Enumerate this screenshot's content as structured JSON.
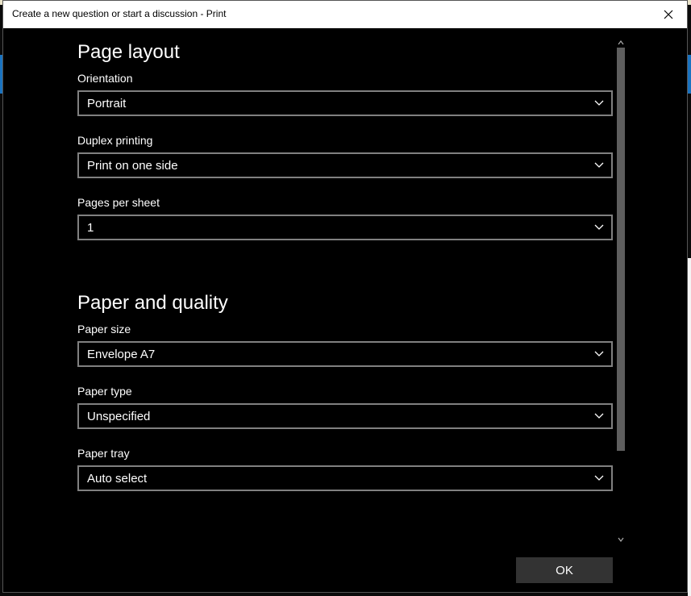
{
  "window": {
    "title": "Create a new question or start a discussion - Print"
  },
  "page_layout": {
    "title": "Page layout",
    "orientation": {
      "label": "Orientation",
      "value": "Portrait"
    },
    "duplex": {
      "label": "Duplex printing",
      "value": "Print on one side"
    },
    "pages_per_sheet": {
      "label": "Pages per sheet",
      "value": "1"
    }
  },
  "paper_quality": {
    "title": "Paper and quality",
    "paper_size": {
      "label": "Paper size",
      "value": "Envelope A7"
    },
    "paper_type": {
      "label": "Paper type",
      "value": "Unspecified"
    },
    "paper_tray": {
      "label": "Paper tray",
      "value": "Auto select"
    }
  },
  "footer": {
    "ok_label": "OK"
  },
  "icons": {
    "close": "close-icon",
    "chevron": "chevron-down-icon"
  },
  "colors": {
    "background": "#000000",
    "text": "#ffffff",
    "field_border": "#808080",
    "button": "#333333",
    "scroll_thumb": "#5e5e5e"
  }
}
